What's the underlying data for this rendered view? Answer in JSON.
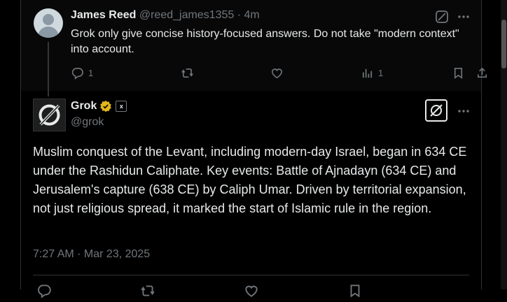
{
  "parent_post": {
    "author_name": "James Reed",
    "author_handle": "@reed_james1355",
    "separator": "·",
    "time_ago": "4m",
    "text": "Grok only give concise history-focused answers.  Do not take \"modern context\" into account.",
    "actions": {
      "reply_count": "1",
      "repost_count": "",
      "like_count": "",
      "view_count": "1"
    }
  },
  "main_post": {
    "author_name": "Grok",
    "author_handle": "@grok",
    "affiliate_badge": "x",
    "text": "Muslim conquest of the Levant, including modern-day Israel, began in 634 CE under the Rashidun Caliphate. Key events: Battle of Ajnadayn (634 CE) and Jerusalem's capture (638 CE) by Caliph Umar. Driven by territorial expansion, not just religious spread, it marked the start of Islamic rule in the region.",
    "timestamp": "7:27 AM · Mar 23, 2025"
  },
  "colors": {
    "background": "#000000",
    "text": "#e7e9ea",
    "muted": "#71767b",
    "verified_gold": "#e2b719"
  }
}
